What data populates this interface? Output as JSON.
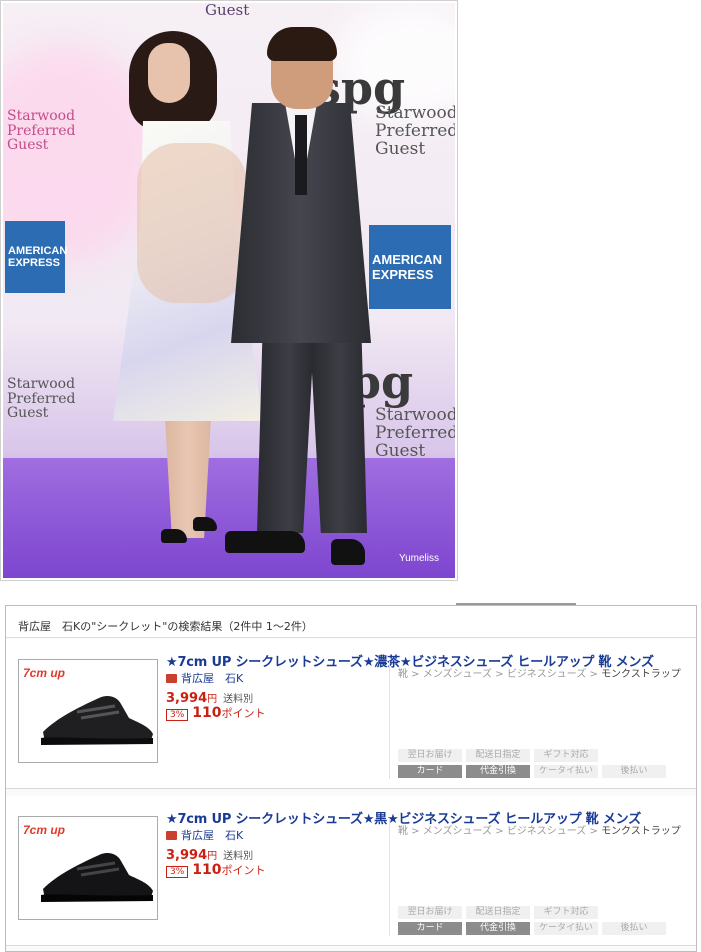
{
  "photo": {
    "banner_top": "Guest",
    "spg_lines": [
      "Starwood",
      "Preferred",
      "Guest"
    ],
    "spg_logo": "spg",
    "amex_lines": [
      "AMERICAN",
      "EXPRESS"
    ],
    "watermark": "Yumeliss"
  },
  "results": {
    "header": "背広屋　石Kの\"シークレット\"の検索結果（2件中 1〜2件）",
    "items": [
      {
        "badge": "7cm up",
        "title": "★7cm UP シークレットシューズ★濃茶★ビジネスシューズ ヒールアップ 靴 メンズ",
        "shop": "背広屋　石K",
        "price": "3,994",
        "yen": "円",
        "shipping": "送料別",
        "point_rate": "3%",
        "points": "110",
        "points_suffix": "ポイント",
        "breadcrumb": [
          "靴",
          "メンズシューズ",
          "ビジネスシューズ",
          "モンクストラップ"
        ],
        "tags_row1": [
          "翌日お届け",
          "配送日指定",
          "ギフト対応"
        ],
        "tags_row2": [
          "カード",
          "代金引換",
          "ケータイ払い",
          "後払い"
        ]
      },
      {
        "badge": "7cm up",
        "title": "★7cm UP シークレットシューズ★黒★ビジネスシューズ ヒールアップ 靴 メンズ",
        "shop": "背広屋　石K",
        "price": "3,994",
        "yen": "円",
        "shipping": "送料別",
        "point_rate": "3%",
        "points": "110",
        "points_suffix": "ポイント",
        "breadcrumb": [
          "靴",
          "メンズシューズ",
          "ビジネスシューズ",
          "モンクストラップ"
        ],
        "tags_row1": [
          "翌日お届け",
          "配送日指定",
          "ギフト対応"
        ],
        "tags_row2": [
          "カード",
          "代金引換",
          "ケータイ払い",
          "後払い"
        ]
      }
    ]
  },
  "colors": {
    "title_blue": "#1a3b95",
    "price_red": "#cc1f14",
    "stage_purple": "#8b55d6",
    "amex_blue": "#2b6cb2"
  }
}
